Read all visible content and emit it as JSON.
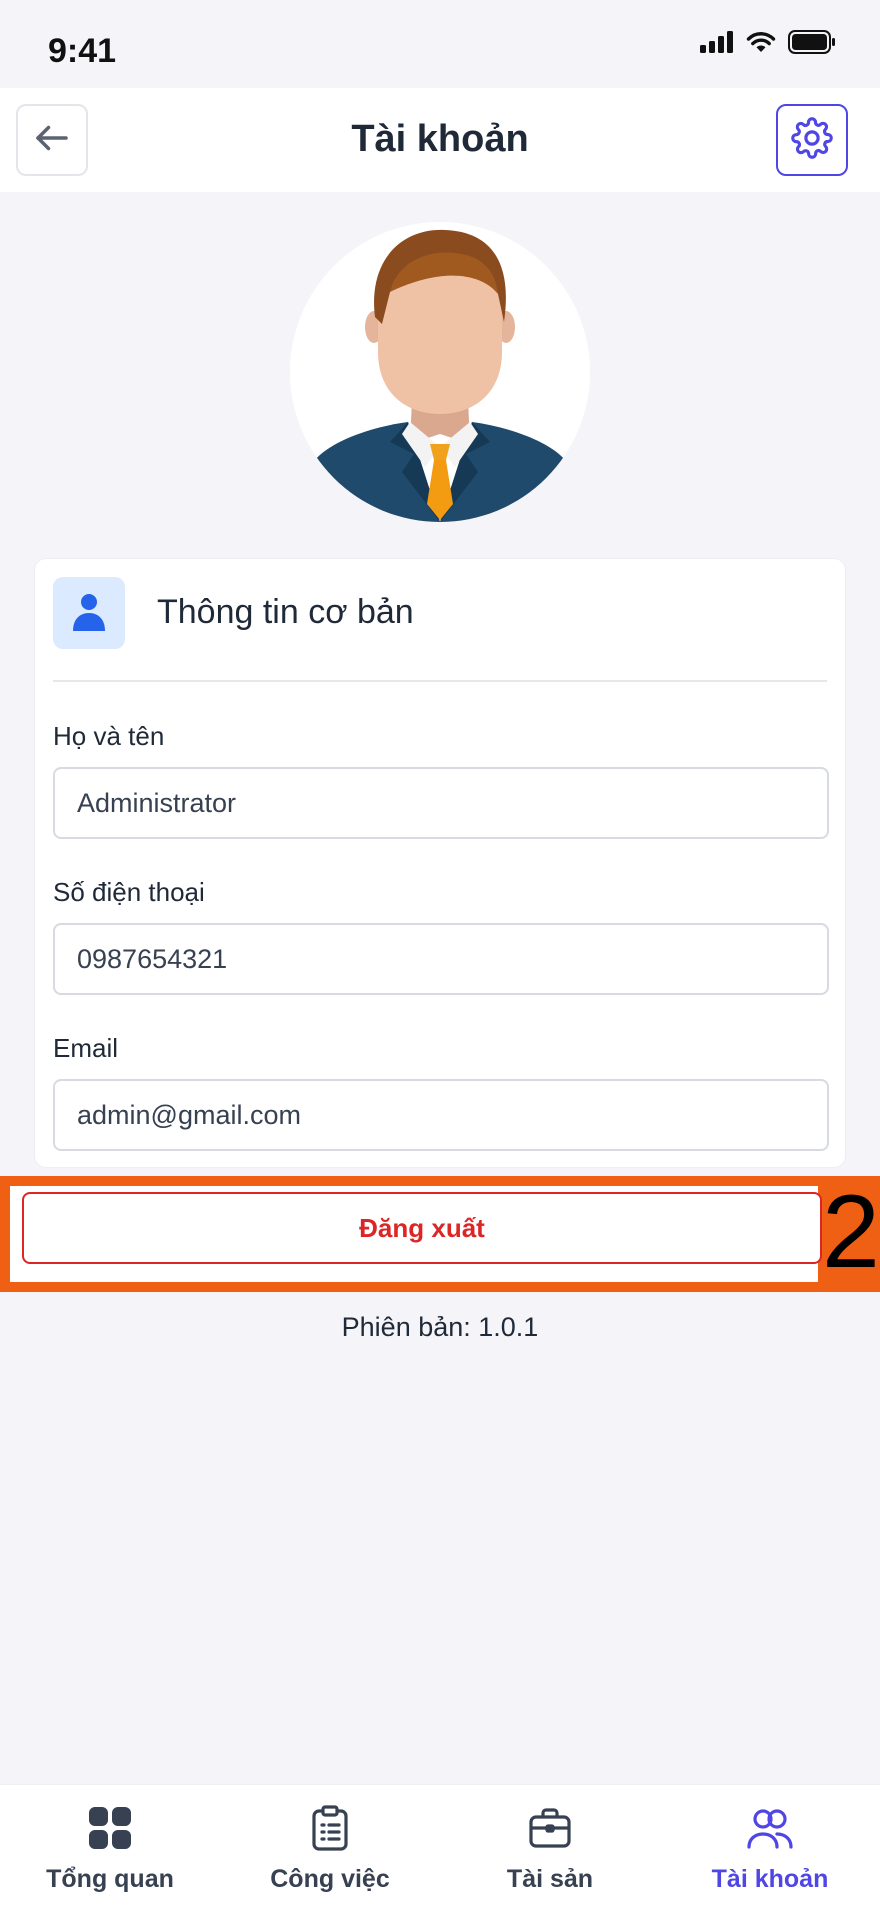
{
  "status_bar": {
    "time": "9:41"
  },
  "header": {
    "title": "Tài khoản",
    "back_icon": "arrow-left-icon",
    "settings_icon": "gear-icon"
  },
  "card": {
    "title": "Thông tin cơ bản",
    "icon": "user-icon",
    "fields": [
      {
        "label": "Họ và tên",
        "value": "Administrator"
      },
      {
        "label": "Số điện thoại",
        "value": "0987654321"
      },
      {
        "label": "Email",
        "value": "admin@gmail.com"
      }
    ]
  },
  "logout": {
    "label": "Đăng xuất"
  },
  "annotation": {
    "number": "2"
  },
  "version": {
    "text": "Phiên bản: 1.0.1"
  },
  "bottom_nav": {
    "items": [
      {
        "label": "Tổng quan",
        "icon": "grid-icon",
        "active": false
      },
      {
        "label": "Công việc",
        "icon": "clipboard-icon",
        "active": false
      },
      {
        "label": "Tài sản",
        "icon": "briefcase-icon",
        "active": false
      },
      {
        "label": "Tài khoản",
        "icon": "users-icon",
        "active": true
      }
    ]
  },
  "colors": {
    "accent": "#4f46e5",
    "danger": "#dc2626",
    "highlight": "#ef5f14",
    "background": "#f5f5f9"
  }
}
